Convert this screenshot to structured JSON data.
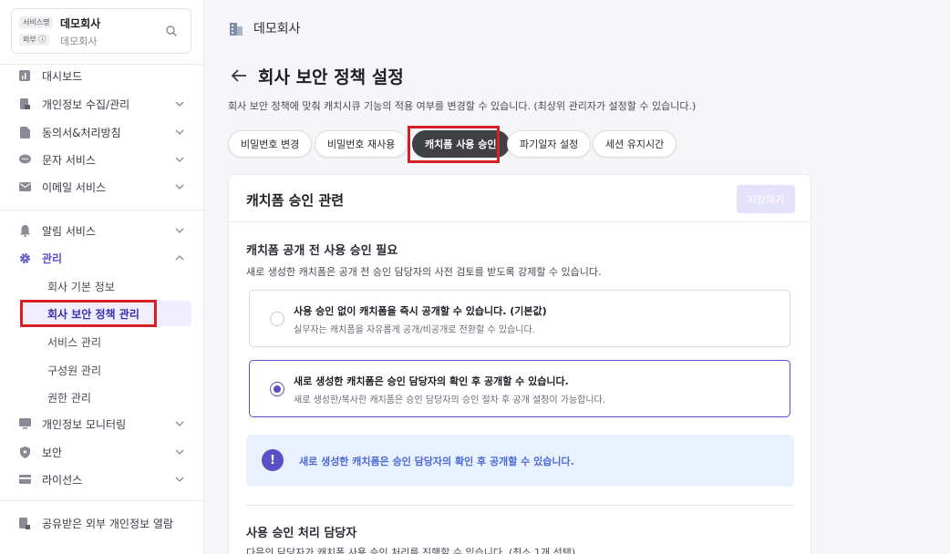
{
  "sidebar": {
    "org": {
      "tag_service": "서비스명",
      "tag_external": "외부",
      "name": "데모회사",
      "sub": "데모회사"
    },
    "menu": [
      {
        "label": "대시보드",
        "icon": "dashboard-icon"
      },
      {
        "label": "개인정보 수집/관리",
        "icon": "document-lock-icon"
      },
      {
        "label": "동의서&처리방침",
        "icon": "document-icon"
      },
      {
        "label": "문자 서비스",
        "icon": "chat-bubble-icon"
      },
      {
        "label": "이메일 서비스",
        "icon": "mail-icon"
      },
      {
        "label": "알림 서비스",
        "icon": "bell-icon"
      },
      {
        "label": "관리",
        "icon": "gear-icon"
      },
      {
        "label": "개인정보 모니터링",
        "icon": "monitor-icon"
      },
      {
        "label": "보안",
        "icon": "shield-icon"
      },
      {
        "label": "라이선스",
        "icon": "card-icon"
      },
      {
        "label": "공유받은 외부 개인정보 열람",
        "icon": "shared-doc-icon"
      }
    ],
    "submenu": [
      "회사 기본 정보",
      "회사 보안 정책 관리",
      "서비스 관리",
      "구성원 관리",
      "권한 관리"
    ]
  },
  "header": {
    "breadcrumb": "데모회사",
    "title": "회사 보안 정책 설정",
    "description": "회사 보안 정책에 맞춰 캐치시큐 기능의 적용 여부를 변경할 수 있습니다. (최상위 관리자가 설정할 수 있습니다.)"
  },
  "tabs": [
    "비밀번호 변경",
    "비밀번호 재사용",
    "캐치폼 사용 승인",
    "파기일자 설정",
    "세션 유지시간"
  ],
  "panel": {
    "title": "캐치폼 승인 관련",
    "save_label": "저장하기",
    "section1_title": "캐치폼 공개 전 사용 승인 필요",
    "section1_desc": "새로 생성한 캐치폼은 공개 전 승인 담당자의 사전 검토를 받도록 강제할 수 있습니다.",
    "options": [
      {
        "title": "사용 승인 없이 캐치폼을 즉시 공개할 수 있습니다. (기본값)",
        "desc": "실무자는 캐치폼을 자유롭게 공개/비공개로 전환할 수 있습니다.",
        "selected": false
      },
      {
        "title": "새로 생성한 캐치폼은 승인 담당자의 확인 후 공개할 수 있습니다.",
        "desc": "새로 생성한/복사한 캐치폼은 승인 담당자의 승인 절차 후 공개 설정이 가능합니다.",
        "selected": true
      }
    ],
    "info_icon": "!",
    "info_text": "새로 생성한 캐치폼은 승인 담당자의 확인 후 공개할 수 있습니다.",
    "section2_title": "사용 승인 처리 담당자",
    "section2_desc": "다음의 담당자가 캐치폼 사용 승인 처리를 진행할 수 있습니다. (최소 1개 선택)"
  },
  "colors": {
    "accent": "#5b4fc6",
    "highlight": "#d61f26",
    "active_tab": "#3f4144",
    "info_bg": "#e8f1fd"
  }
}
